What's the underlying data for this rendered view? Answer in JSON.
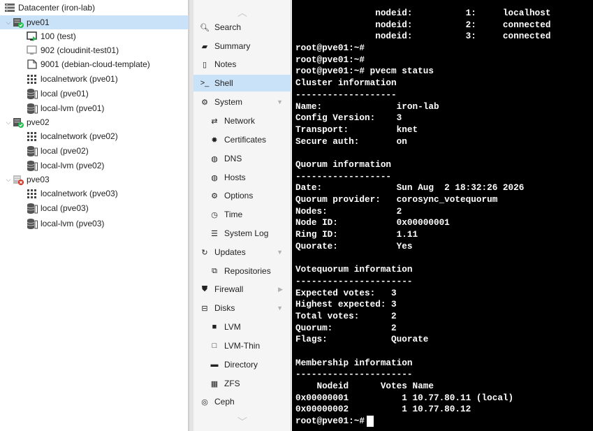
{
  "tree": {
    "items": [
      {
        "label": "Datacenter (iron-lab)",
        "icon": "datacenter-icon"
      },
      {
        "label": "pve01",
        "icon": "node-online-icon"
      },
      {
        "label": "100 (test)",
        "icon": "vm-running-icon"
      },
      {
        "label": "902 (cloudinit-test01)",
        "icon": "vm-stopped-icon"
      },
      {
        "label": "9001 (debian-cloud-template)",
        "icon": "template-icon"
      },
      {
        "label": "localnetwork (pve01)",
        "icon": "network-icon"
      },
      {
        "label": "local (pve01)",
        "icon": "storage-icon"
      },
      {
        "label": "local-lvm (pve01)",
        "icon": "storage-icon"
      },
      {
        "label": "pve02",
        "icon": "node-online-icon"
      },
      {
        "label": "localnetwork (pve02)",
        "icon": "network-icon"
      },
      {
        "label": "local (pve02)",
        "icon": "storage-icon"
      },
      {
        "label": "local-lvm (pve02)",
        "icon": "storage-icon"
      },
      {
        "label": "pve03",
        "icon": "node-offline-icon"
      },
      {
        "label": "localnetwork (pve03)",
        "icon": "network-icon"
      },
      {
        "label": "local (pve03)",
        "icon": "storage-icon"
      },
      {
        "label": "local-lvm (pve03)",
        "icon": "storage-icon"
      }
    ]
  },
  "nav": {
    "items": [
      {
        "label": "Search",
        "icon": "search-icon"
      },
      {
        "label": "Summary",
        "icon": "book-icon"
      },
      {
        "label": "Notes",
        "icon": "notes-icon"
      },
      {
        "label": "Shell",
        "icon": "terminal-icon"
      },
      {
        "label": "System",
        "icon": "gears-icon"
      },
      {
        "label": "Network",
        "icon": "exchange-icon"
      },
      {
        "label": "Certificates",
        "icon": "certificate-icon"
      },
      {
        "label": "DNS",
        "icon": "globe-icon"
      },
      {
        "label": "Hosts",
        "icon": "globe-icon"
      },
      {
        "label": "Options",
        "icon": "gear-icon"
      },
      {
        "label": "Time",
        "icon": "clock-icon"
      },
      {
        "label": "System Log",
        "icon": "list-icon"
      },
      {
        "label": "Updates",
        "icon": "refresh-icon"
      },
      {
        "label": "Repositories",
        "icon": "files-icon"
      },
      {
        "label": "Firewall",
        "icon": "shield-icon"
      },
      {
        "label": "Disks",
        "icon": "hdd-icon"
      },
      {
        "label": "LVM",
        "icon": "square-icon"
      },
      {
        "label": "LVM-Thin",
        "icon": "square-outline-icon"
      },
      {
        "label": "Directory",
        "icon": "folder-icon"
      },
      {
        "label": "ZFS",
        "icon": "grid-icon"
      },
      {
        "label": "Ceph",
        "icon": "ceph-icon"
      }
    ]
  },
  "terminal": {
    "lines": [
      "               nodeid:          1:     localhost",
      "               nodeid:          2:     connected",
      "               nodeid:          3:     connected",
      "root@pve01:~#",
      "root@pve01:~#",
      "root@pve01:~# pvecm status",
      "Cluster information",
      "-------------------",
      "Name:              iron-lab",
      "Config Version:    3",
      "Transport:         knet",
      "Secure auth:       on",
      "",
      "Quorum information",
      "------------------",
      "Date:              Sun Aug  2 18:32:26 2026",
      "Quorum provider:   corosync_votequorum",
      "Nodes:             2",
      "Node ID:           0x00000001",
      "Ring ID:           1.11",
      "Quorate:           Yes",
      "",
      "Votequorum information",
      "----------------------",
      "Expected votes:   3",
      "Highest expected: 3",
      "Total votes:      2",
      "Quorum:           2",
      "Flags:            Quorate",
      "",
      "Membership information",
      "----------------------",
      "    Nodeid      Votes Name",
      "0x00000001          1 10.77.80.11 (local)",
      "0x00000002          1 10.77.80.12",
      "root@pve01:~# "
    ]
  }
}
